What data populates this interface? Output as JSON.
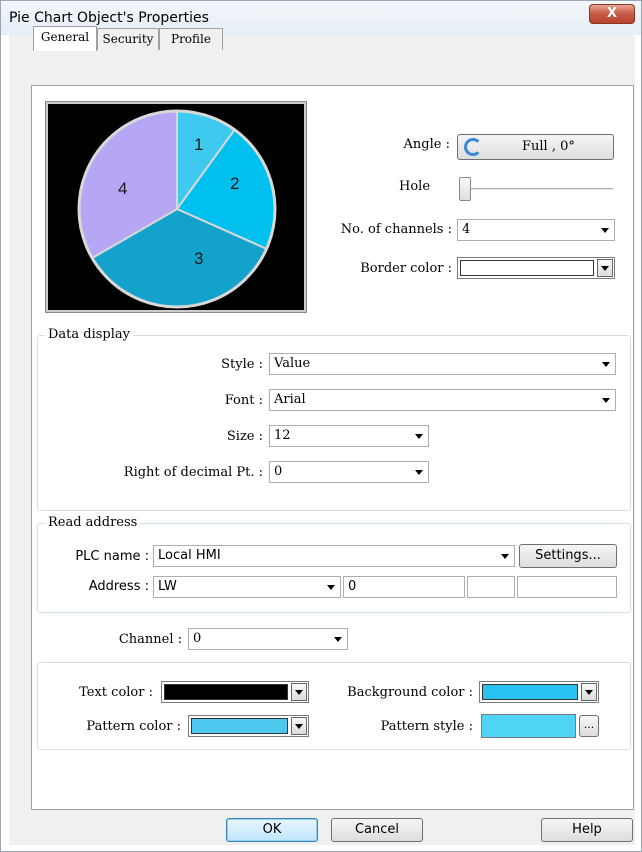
{
  "window": {
    "title": "Pie Chart Object's Properties",
    "close_label": "X"
  },
  "tabs": [
    {
      "label": "General",
      "active": true
    },
    {
      "label": "Security",
      "active": false
    },
    {
      "label": "Profile",
      "active": false
    }
  ],
  "preview": {
    "slices": [
      {
        "label": "1",
        "color": "#3ec9ef"
      },
      {
        "label": "2",
        "color": "#00c0f0"
      },
      {
        "label": "3",
        "color": "#13a2cb"
      },
      {
        "label": "4",
        "color": "#b7a6f4"
      }
    ],
    "background": "#000000"
  },
  "general": {
    "angle_label": "Angle :",
    "angle_value": "Full , 0°",
    "hole_label": "Hole",
    "channels_label": "No. of channels :",
    "channels_value": "4",
    "border_color_label": "Border color :",
    "border_color": "#ffffff"
  },
  "data_display": {
    "title": "Data display",
    "style_label": "Style :",
    "style_value": "Value",
    "font_label": "Font :",
    "font_value": "Arial",
    "size_label": "Size :",
    "size_value": "12",
    "decimal_label": "Right of decimal Pt. :",
    "decimal_value": "0"
  },
  "read_address": {
    "title": "Read address",
    "plc_label": "PLC name :",
    "plc_value": "Local HMI",
    "settings_label": "Settings...",
    "address_label": "Address :",
    "address_device": "LW",
    "address_value": "0"
  },
  "channel": {
    "label": "Channel :",
    "value": "0"
  },
  "colors": {
    "text_color_label": "Text color :",
    "text_color": "#000000",
    "background_color_label": "Background color :",
    "background_color": "#29c1ef",
    "pattern_color_label": "Pattern color :",
    "pattern_color": "#4fc8ef",
    "pattern_style_label": "Pattern style :",
    "pattern_style_color": "#4fd4f6",
    "pattern_style_button": "..."
  },
  "footer": {
    "ok_label": "OK",
    "cancel_label": "Cancel",
    "help_label": "Help"
  }
}
